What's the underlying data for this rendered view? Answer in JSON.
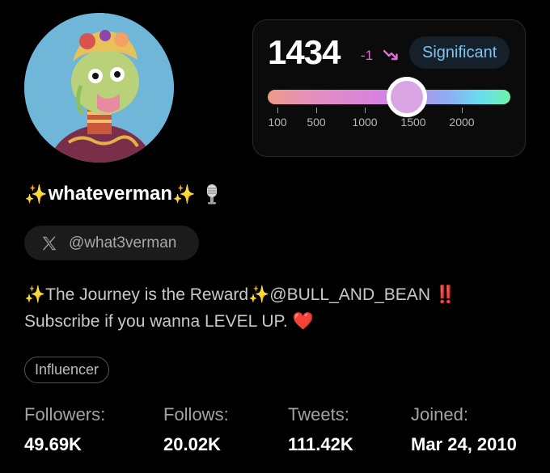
{
  "avatar": {
    "alt": "profile avatar",
    "bg_color": "#6fb6d9"
  },
  "score": {
    "value": "1434",
    "delta": "-1",
    "trend_icon": "trend-down-icon",
    "badge": "Significant",
    "gauge": {
      "min": 0,
      "max": 2500,
      "value": 1434,
      "ticks": [
        "100",
        "500",
        "1000",
        "1500",
        "2000"
      ],
      "tick_values": [
        100,
        500,
        1000,
        1500,
        2000
      ]
    }
  },
  "profile": {
    "name_sparkle_left": "✨",
    "name": "whateverman",
    "name_sparkle_right": "✨",
    "name_icon": "microphone-icon",
    "handle_icon": "x-logo-icon",
    "handle": "@what3verman",
    "bio_line1_a": "✨The Journey is the Reward✨@BULL_AND_BEAN ",
    "bio_line1_b": "‼️",
    "bio_line2": "Subscribe if you wanna LEVEL UP. ",
    "bio_heart": "❤️",
    "tag": "Influencer"
  },
  "stats": [
    {
      "label": "Followers:",
      "value": "49.69K"
    },
    {
      "label": "Follows:",
      "value": "20.02K"
    },
    {
      "label": "Tweets:",
      "value": "111.42K"
    },
    {
      "label": "Joined:",
      "value": "Mar 24, 2010"
    }
  ],
  "colors": {
    "accent_pink": "#e36ad8",
    "badge_text": "#7fc4ee",
    "badge_bg": "#16202a"
  }
}
